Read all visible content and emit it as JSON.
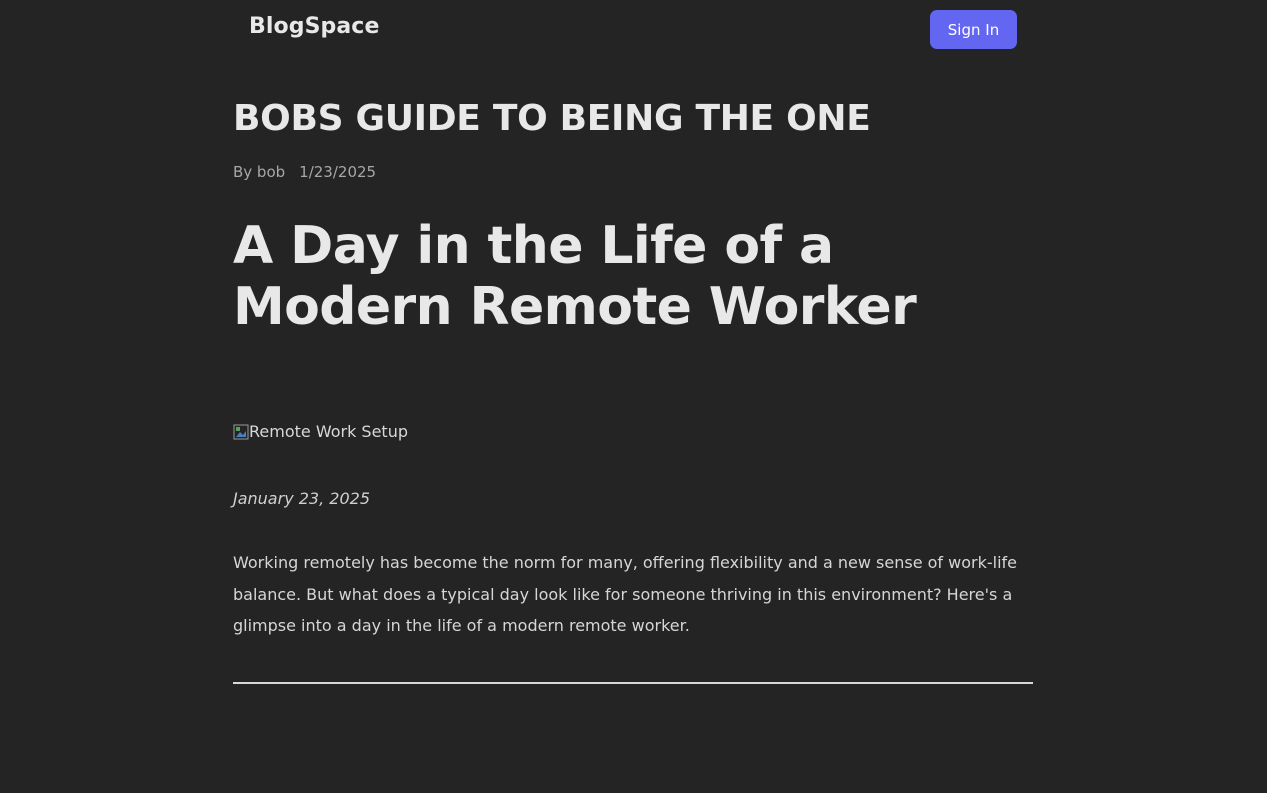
{
  "header": {
    "brand": "BlogSpace",
    "sign_in_label": "Sign In"
  },
  "post": {
    "title": "BOBS GUIDE TO BEING THE ONE",
    "author_text": "By bob",
    "date": "1/23/2025"
  },
  "article": {
    "title": "A Day in the Life of a Modern Remote Worker",
    "image_alt": "Remote Work Setup",
    "published_date": "January 23, 2025",
    "intro": "Working remotely has become the norm for many, offering flexibility and a new sense of work-life balance. But what does a typical day look like for someone thriving in this environment? Here's a glimpse into a day in the life of a modern remote worker."
  },
  "colors": {
    "background": "#242424",
    "accent": "#6366f1",
    "text": "#e6e6e6"
  }
}
